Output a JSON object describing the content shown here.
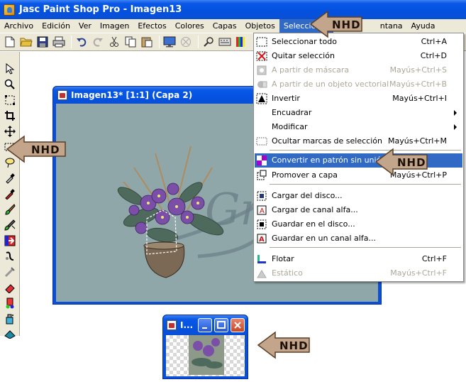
{
  "app": {
    "title": "Jasc Paint Shop Pro - Imagen13"
  },
  "menubar": {
    "items": [
      "Archivo",
      "Edición",
      "Ver",
      "Imagen",
      "Efectos",
      "Colores",
      "Capas",
      "Objetos",
      "Seleccionar",
      "N",
      "ntana",
      "Ayuda"
    ],
    "active": "Seleccionar"
  },
  "toolbar": {
    "buttons": [
      "new-icon",
      "open-icon",
      "save-icon",
      "print-icon",
      "undo-icon",
      "redo-icon",
      "cut-icon",
      "copy-icon",
      "paste-icon",
      "browse-icon",
      "stop-icon",
      "zoom-icon",
      "keyboard-icon",
      "palette-icon"
    ]
  },
  "tools": [
    "arrow-tool-icon",
    "zoom-tool-icon",
    "deform-tool-icon",
    "crop-tool-icon",
    "mover-tool-icon",
    "selection-tool-icon",
    "lasso-tool-icon",
    "dropper-tool-icon",
    "color-dropper-icon",
    "paint-brush-icon",
    "clone-brush-icon",
    "color-replacer-icon",
    "retouch-icon",
    "scratch-remover-icon",
    "eraser-icon",
    "picture-tube-icon",
    "airbrush-icon",
    "flood-fill-icon"
  ],
  "image_window": {
    "title": "Imagen13* [1:1] (Capa 2)",
    "watermark_text": "Gr"
  },
  "dropdown": {
    "items": [
      {
        "label": "Seleccionar todo",
        "shortcut": "Ctrl+A",
        "disabled": false,
        "icon": "select-all-icon"
      },
      {
        "label": "Quitar selección",
        "shortcut": "Ctrl+D",
        "disabled": false,
        "icon": "select-none-icon"
      },
      {
        "label": "A partir de máscara",
        "shortcut": "Mayús+Ctrl+S",
        "disabled": true,
        "icon": "from-mask-icon"
      },
      {
        "label": "A partir de un objeto vectorial",
        "shortcut": "Mayús+Ctrl+B",
        "disabled": true,
        "icon": "from-vector-icon"
      },
      {
        "label": "Invertir",
        "shortcut": "Mayús+Ctrl+I",
        "disabled": false,
        "icon": "invert-icon"
      },
      {
        "label": "Encuadrar",
        "shortcut": "",
        "disabled": false,
        "icon": "",
        "submenu": true
      },
      {
        "label": "Modificar",
        "shortcut": "",
        "disabled": false,
        "icon": "",
        "submenu": true
      },
      {
        "label": "Ocultar marcas de selección",
        "shortcut": "Mayús+Ctrl+M",
        "disabled": false,
        "icon": "hide-marquee-icon"
      },
      {
        "label": "Convertir en patrón sin unión",
        "shortcut": "",
        "disabled": false,
        "icon": "seamless-icon",
        "highlighted": true
      },
      {
        "label": "Promover a capa",
        "shortcut": "Mayús+Ctrl+P",
        "disabled": false,
        "icon": "promote-layer-icon"
      },
      {
        "label": "Cargar del disco...",
        "shortcut": "",
        "disabled": false,
        "icon": "load-disk-icon"
      },
      {
        "label": "Cargar de canal alfa...",
        "shortcut": "",
        "disabled": false,
        "icon": "load-alpha-icon"
      },
      {
        "label": "Guardar en el disco...",
        "shortcut": "",
        "disabled": false,
        "icon": "save-disk-icon"
      },
      {
        "label": "Guardar en un canal alfa...",
        "shortcut": "",
        "disabled": false,
        "icon": "save-alpha-icon"
      },
      {
        "label": "Flotar",
        "shortcut": "Ctrl+F",
        "disabled": false,
        "icon": "float-icon"
      },
      {
        "label": "Estático",
        "shortcut": "Mayús+Ctrl+F",
        "disabled": true,
        "icon": "defloat-icon"
      }
    ]
  },
  "mini_window": {
    "title": "I..."
  },
  "badges": {
    "text": "NHD",
    "color": "#c2a58a"
  },
  "colors": {
    "titlebar": "#0a4fd4",
    "menu_highlight": "#316ac5",
    "chrome": "#ece9d8",
    "canvas": "#8fa7a8"
  }
}
